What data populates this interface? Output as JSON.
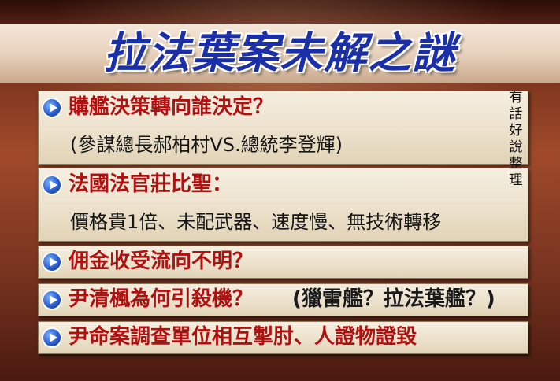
{
  "title": "拉法葉案未解之謎",
  "side_note": "有話好說整理",
  "items": [
    {
      "lines": [
        "購艦決策轉向誰決定？",
        "(參謀總長郝柏村VS.總統李登輝)"
      ]
    },
    {
      "lines": [
        "法國法官莊比聖：",
        "價格貴1倍、未配武器、速度慢、無技術轉移"
      ]
    },
    {
      "lines": [
        "佣金收受流向不明？"
      ]
    },
    {
      "lines": [
        "尹清楓為何引殺機？",
        "(獵雷艦？拉法葉艦？)"
      ]
    },
    {
      "lines": [
        "尹命案調查單位相互掣肘、人證物證毀"
      ]
    }
  ],
  "colors": {
    "headline": "#b01010",
    "title": "#1a2fa8"
  }
}
